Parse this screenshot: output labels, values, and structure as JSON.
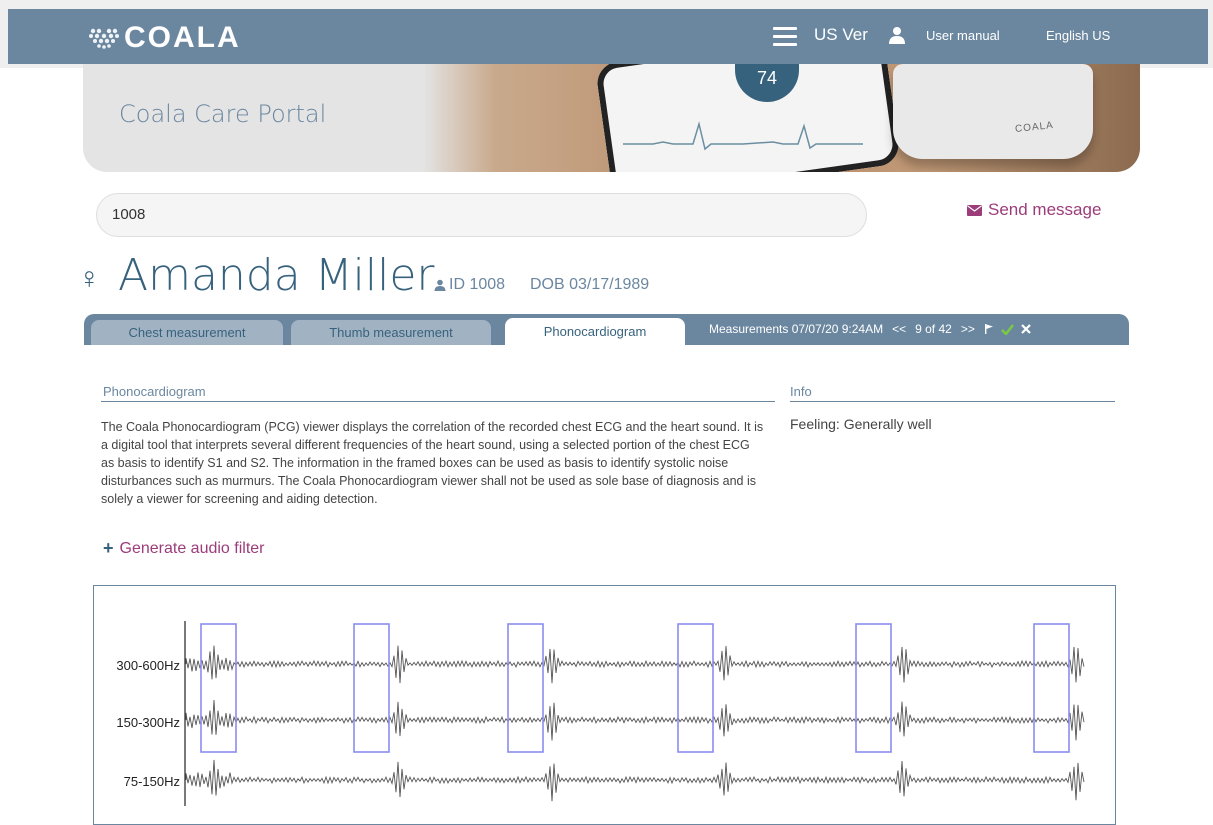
{
  "nav": {
    "logo_text": "COALA",
    "version": "US Ver",
    "user_manual": "User manual",
    "language": "English US",
    "icons": [
      "heart-logo-icon",
      "hamburger-menu-icon",
      "user-icon"
    ]
  },
  "banner": {
    "title": "Coala Care Portal",
    "phone_value": "74",
    "device_brand": "COALA"
  },
  "search": {
    "value": "1008"
  },
  "send_message": "Send message",
  "patient": {
    "gender_symbol": "♀",
    "name": "Amanda Miller",
    "id": "ID 1008",
    "dob": "DOB 03/17/1989"
  },
  "tabs": [
    {
      "label": "Chest measurement",
      "active": false
    },
    {
      "label": "Thumb measurement",
      "active": false
    },
    {
      "label": "Phonocardiogram",
      "active": true
    }
  ],
  "measurements": {
    "label": "Measurements 07/07/20 9:24AM",
    "prev": "<<",
    "counter": "9 of 42",
    "next": ">>"
  },
  "section": {
    "title": "Phonocardiogram",
    "info_title": "Info",
    "description": "The Coala Phonocardiogram (PCG) viewer displays the correlation of the recorded chest ECG and the heart sound. It is a digital tool that interprets several different frequencies of the heart sound, using a selected portion of the chest ECG as basis to identify S1 and S2. The information in the framed boxes can be used as basis to identify systolic noise disturbances such as murmurs. The Coala Phonocardiogram viewer shall not be used as sole base of diagnosis and is solely a viewer for screening and aiding detection.",
    "feeling": "Feeling: Generally well",
    "generate_audio": "Generate audio filter"
  },
  "graph": {
    "bands": [
      "300-600Hz",
      "150-300Hz",
      "75-150Hz"
    ]
  },
  "colors": {
    "nav": "#6b87a0",
    "primary": "#37627d",
    "accent": "#9c3c7a",
    "box": "#8b8ef0"
  }
}
